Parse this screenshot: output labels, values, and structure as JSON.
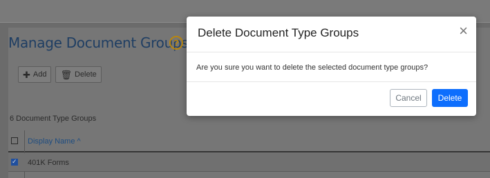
{
  "page": {
    "title": "Manage Document Groups",
    "help_icon_glyph": "?",
    "toolbar": {
      "add_label": "Add",
      "add_icon": "plus-icon",
      "delete_label": "Delete",
      "delete_icon": "trash-icon"
    },
    "count_text": "6 Document Type Groups",
    "table": {
      "columns": [
        "Display Name ^"
      ],
      "rows": [
        {
          "checked": true,
          "display_name": "401K Forms"
        }
      ]
    }
  },
  "modal": {
    "title": "Delete Document Type Groups",
    "close_glyph": "×",
    "body": "Are you sure you want to delete the selected document type groups?",
    "cancel_label": "Cancel",
    "delete_label": "Delete"
  },
  "colors": {
    "overlay": "#6b6b6b",
    "title": "#1f3e63",
    "help": "#b9860f",
    "primary": "#0d6efd"
  }
}
